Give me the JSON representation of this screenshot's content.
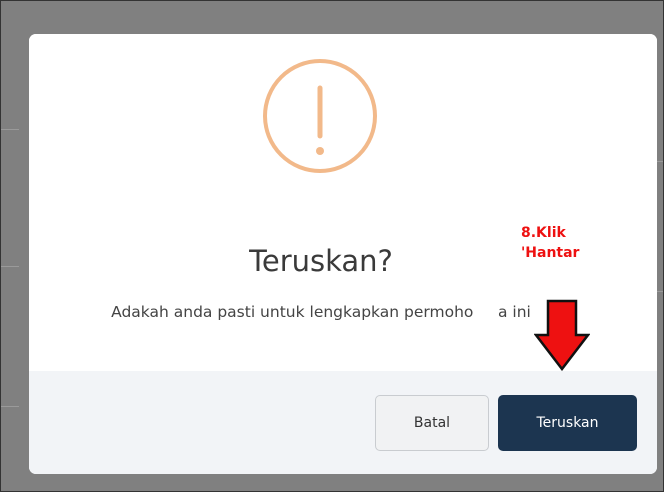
{
  "dialog": {
    "title": "Teruskan?",
    "message": "Adakah anda pasti untuk lengkapkan permoho     a ini",
    "icon": "exclamation-circle-icon",
    "icon_color": "#f2b98a"
  },
  "buttons": {
    "cancel_label": "Batal",
    "continue_label": "Teruskan",
    "continue_color": "#1c3550"
  },
  "annotation": {
    "line1": "8.Klik",
    "line2": "'Hantar",
    "color": "#ee1111",
    "arrow_icon": "arrow-down-icon"
  }
}
